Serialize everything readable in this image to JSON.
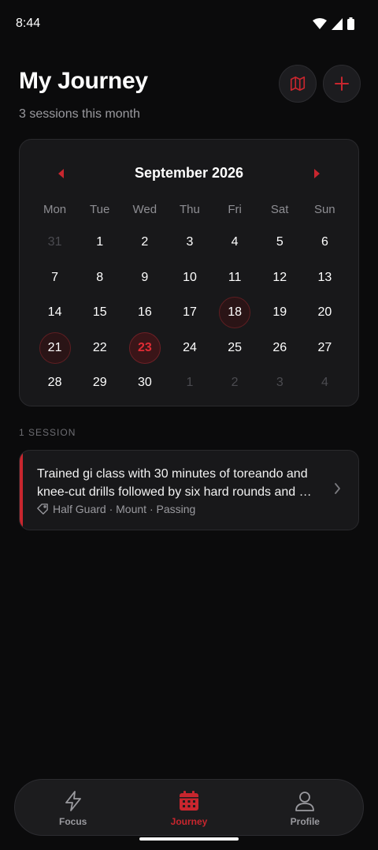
{
  "status": {
    "time": "8:44"
  },
  "header": {
    "title": "My Journey",
    "subtitle": "3 sessions this month",
    "map_icon": "map-icon",
    "add_icon": "plus-icon"
  },
  "calendar": {
    "month_label": "September 2026",
    "weekdays": [
      "Mon",
      "Tue",
      "Wed",
      "Thu",
      "Fri",
      "Sat",
      "Sun"
    ],
    "days": [
      {
        "n": "31",
        "muted": true
      },
      {
        "n": "1"
      },
      {
        "n": "2"
      },
      {
        "n": "3"
      },
      {
        "n": "4"
      },
      {
        "n": "5"
      },
      {
        "n": "6"
      },
      {
        "n": "7"
      },
      {
        "n": "8"
      },
      {
        "n": "9"
      },
      {
        "n": "10"
      },
      {
        "n": "11"
      },
      {
        "n": "12"
      },
      {
        "n": "13"
      },
      {
        "n": "14"
      },
      {
        "n": "15"
      },
      {
        "n": "16"
      },
      {
        "n": "17"
      },
      {
        "n": "18",
        "session": true
      },
      {
        "n": "19"
      },
      {
        "n": "20"
      },
      {
        "n": "21",
        "session": true
      },
      {
        "n": "22"
      },
      {
        "n": "23",
        "today": true
      },
      {
        "n": "24"
      },
      {
        "n": "25"
      },
      {
        "n": "26"
      },
      {
        "n": "27"
      },
      {
        "n": "28"
      },
      {
        "n": "29"
      },
      {
        "n": "30"
      },
      {
        "n": "1",
        "muted": true
      },
      {
        "n": "2",
        "muted": true
      },
      {
        "n": "3",
        "muted": true
      },
      {
        "n": "4",
        "muted": true
      }
    ]
  },
  "sessions": {
    "count_label": "1 SESSION",
    "items": [
      {
        "text": "Trained gi class with 30 minutes of toreando and knee-cut drills followed by six hard rounds and …",
        "tags": "Half Guard · Mount · Passing"
      }
    ]
  },
  "nav": {
    "items": [
      {
        "label": "Focus"
      },
      {
        "label": "Journey"
      },
      {
        "label": "Profile"
      }
    ]
  },
  "colors": {
    "accent": "#c8262e",
    "background": "#0b0b0c",
    "card": "#18181a"
  }
}
